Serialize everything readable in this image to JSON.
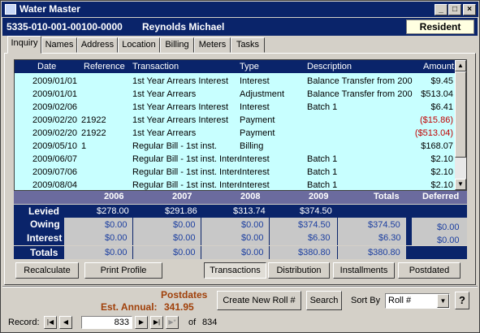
{
  "window": {
    "title": "Water Master",
    "account": "5335-010-001-00100-0000",
    "owner": "Reynolds Michael",
    "status_badge": "Resident",
    "minimize": "_",
    "maximize": "□",
    "close": "×"
  },
  "tabs": [
    "Inquiry",
    "Names",
    "Address",
    "Location",
    "Billing",
    "Meters",
    "Tasks"
  ],
  "grid": {
    "columns": [
      "Date",
      "Reference",
      "Transaction",
      "Type",
      "Description",
      "Amount"
    ],
    "rows": [
      {
        "date": "2009/01/01",
        "ref": "",
        "trans": "1st Year Arrears Interest",
        "type": "Interest",
        "desc": "Balance Transfer from 200",
        "amount": "$9.45"
      },
      {
        "date": "2009/01/01",
        "ref": "",
        "trans": "1st Year Arrears",
        "type": "Adjustment",
        "desc": "Balance Transfer from 200",
        "amount": "$513.04"
      },
      {
        "date": "2009/02/06",
        "ref": "",
        "trans": "1st Year Arrears Interest",
        "type": "Interest",
        "desc": "Batch 1",
        "amount": "$6.41"
      },
      {
        "date": "2009/02/20",
        "ref": "21922",
        "trans": "1st Year Arrears Interest",
        "type": "Payment",
        "desc": "",
        "amount": "($15.86)"
      },
      {
        "date": "2009/02/20",
        "ref": "21922",
        "trans": "1st Year Arrears",
        "type": "Payment",
        "desc": "",
        "amount": "($513.04)"
      },
      {
        "date": "2009/05/10",
        "ref": "1",
        "trans": "Regular Bill - 1st inst.",
        "type": "Billing",
        "desc": "",
        "amount": "$168.07"
      },
      {
        "date": "2009/06/07",
        "ref": "",
        "trans": "Regular Bill - 1st inst. Interest",
        "type": "Interest",
        "desc": "Batch 1",
        "amount": "$2.10"
      },
      {
        "date": "2009/07/06",
        "ref": "",
        "trans": "Regular Bill - 1st inst. Interest",
        "type": "Interest",
        "desc": "Batch 1",
        "amount": "$2.10"
      },
      {
        "date": "2009/08/04",
        "ref": "",
        "trans": "Regular Bill - 1st inst. Interest",
        "type": "Interest",
        "desc": "Batch 1",
        "amount": "$2.10"
      }
    ],
    "negative_color": "#c00000"
  },
  "summary": {
    "headers": [
      "2006",
      "2007",
      "2008",
      "2009",
      "Totals",
      "Deferred"
    ],
    "levied_label": "Levied",
    "levied": [
      "$278.00",
      "$291.86",
      "$313.74",
      "$374.50",
      "",
      ""
    ],
    "owing_label": "Owing",
    "owing": [
      "$0.00",
      "$0.00",
      "$0.00",
      "$374.50",
      "$374.50",
      "$0.00"
    ],
    "interest_label": "Interest",
    "interest": [
      "$0.00",
      "$0.00",
      "$0.00",
      "$6.30",
      "$6.30",
      "$0.00"
    ],
    "totals_label": "Totals",
    "totals": [
      "$0.00",
      "$0.00",
      "$0.00",
      "$380.80",
      "$380.80",
      ""
    ]
  },
  "buttons": {
    "recalculate": "Recalculate",
    "print_profile": "Print Profile",
    "transactions": "Transactions",
    "distribution": "Distribution",
    "installments": "Installments",
    "postdated": "Postdated",
    "create_new_roll": "Create New Roll #",
    "search": "Search",
    "help": "?"
  },
  "footer": {
    "postdates_label": "Postdates",
    "est_annual_label": "Est. Annual:",
    "est_annual_value": "341.95",
    "sort_by_label": "Sort By",
    "sort_by_value": "Roll #",
    "record_label": "Record:",
    "record_current": "833",
    "of_label": "of",
    "record_total": "834"
  }
}
